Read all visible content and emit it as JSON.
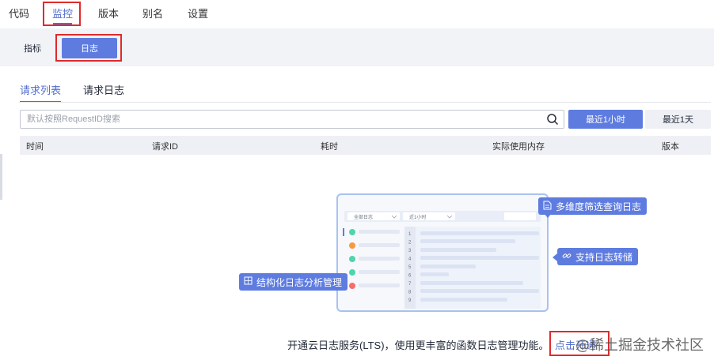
{
  "top_tabs": [
    {
      "label": "代码"
    },
    {
      "label": "监控",
      "active": true
    },
    {
      "label": "版本"
    },
    {
      "label": "别名"
    },
    {
      "label": "设置"
    }
  ],
  "sub_toolbar": {
    "metrics_label": "指标",
    "logs_label": "日志"
  },
  "inner_tabs": [
    {
      "label": "请求列表",
      "active": true
    },
    {
      "label": "请求日志"
    }
  ],
  "search": {
    "placeholder": "默认按照RequestID搜索"
  },
  "time_range": {
    "hour_label": "最近1小时",
    "day_label": "最近1天",
    "selected": "最近1小时"
  },
  "table": {
    "columns": [
      "时间",
      "请求ID",
      "耗时",
      "实际使用内存",
      "版本"
    ]
  },
  "illustration": {
    "dropdown_all_logs": "全部日志",
    "dropdown_recent": "近1小时",
    "line_numbers": [
      "1",
      "2",
      "3",
      "4",
      "5",
      "6",
      "7",
      "8",
      "9"
    ],
    "row_status": [
      "success",
      "warning",
      "success",
      "success",
      "error"
    ],
    "callouts": {
      "multi_filter": "多维度筛选查询日志",
      "transfer": "支持日志转储",
      "structured": "结构化日志分析管理"
    }
  },
  "bottom": {
    "message": "开通云日志服务(LTS)，使用更丰富的函数日志管理功能。",
    "link": "点击开通",
    "watermark": "@稀土掘金技术社区"
  },
  "colors": {
    "accent": "#5e7ce0",
    "highlight_box": "#e02a2a",
    "success": "#50d4ab",
    "warning": "#fa9841",
    "error": "#f66f6a"
  }
}
